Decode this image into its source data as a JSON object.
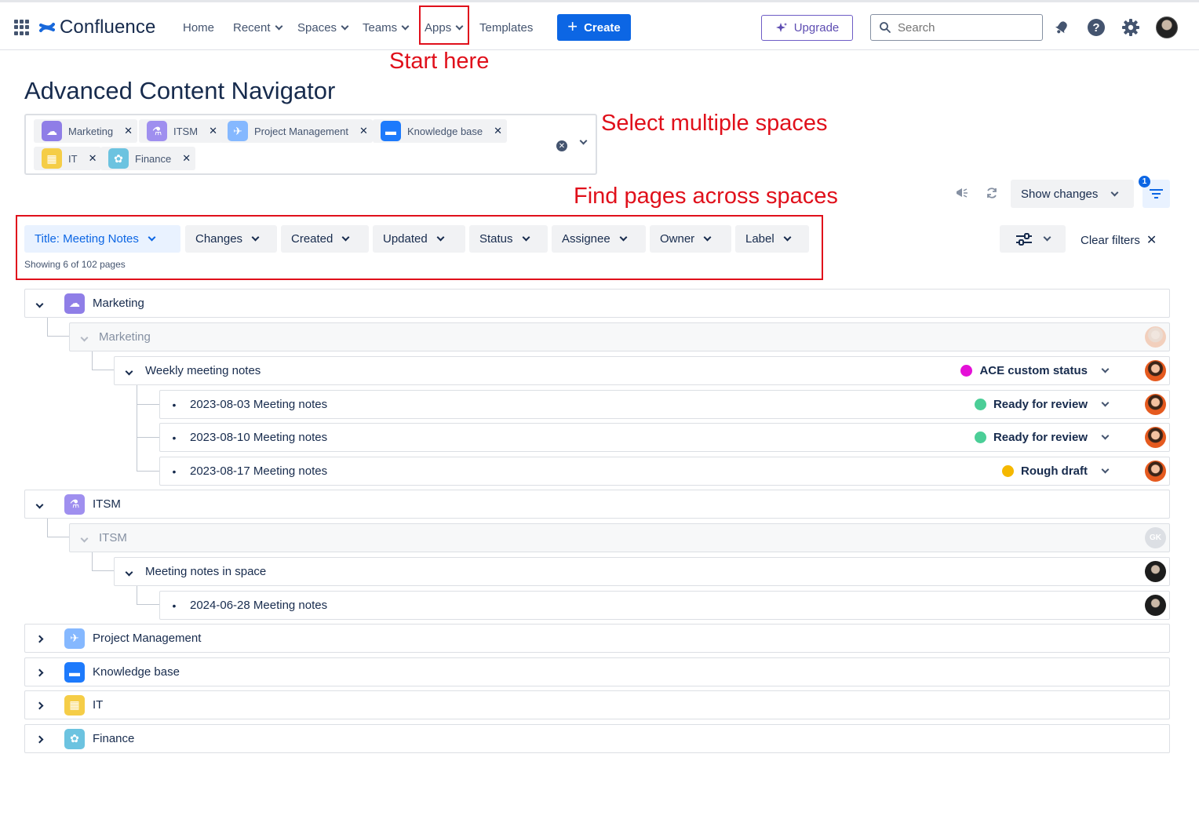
{
  "nav": {
    "brand": "Confluence",
    "items": [
      {
        "label": "Home",
        "dropdown": false
      },
      {
        "label": "Recent",
        "dropdown": true
      },
      {
        "label": "Spaces",
        "dropdown": true
      },
      {
        "label": "Teams",
        "dropdown": true
      },
      {
        "label": "Apps",
        "dropdown": true
      },
      {
        "label": "Templates",
        "dropdown": false
      }
    ],
    "create_label": "Create",
    "upgrade_label": "Upgrade",
    "search_placeholder": "Search",
    "icons": [
      "app-switcher-icon",
      "notifications-icon",
      "help-icon",
      "settings-icon",
      "profile-avatar"
    ]
  },
  "annotations": {
    "start_here": "Start here",
    "select_spaces": "Select multiple spaces",
    "find_pages": "Find pages across spaces",
    "color": "#e0101b"
  },
  "page": {
    "title": "Advanced Content Navigator"
  },
  "selected_spaces": [
    {
      "name": "Marketing",
      "icon": "marketing-space-icon"
    },
    {
      "name": "ITSM",
      "icon": "itsm-space-icon"
    },
    {
      "name": "Project Management",
      "icon": "project-management-space-icon"
    },
    {
      "name": "Knowledge base",
      "icon": "knowledge-base-space-icon"
    },
    {
      "name": "IT",
      "icon": "it-space-icon"
    },
    {
      "name": "Finance",
      "icon": "finance-space-icon"
    }
  ],
  "toolbar": {
    "show_changes": "Show changes",
    "filter_badge": "1"
  },
  "filters": {
    "buttons": [
      "Title: Meeting Notes",
      "Changes",
      "Created",
      "Updated",
      "Status",
      "Assignee",
      "Owner",
      "Label"
    ],
    "showing": "Showing 6 of 102 pages",
    "clear_filters": "Clear filters"
  },
  "tree": {
    "marketing": {
      "space": "Marketing",
      "home": "Marketing",
      "parent": "Weekly meeting notes",
      "parent_status": {
        "label": "ACE custom status",
        "color": "#e410d7"
      },
      "pages": [
        {
          "title": "2023-08-03 Meeting notes",
          "status": "Ready for review",
          "color": "#4bce97"
        },
        {
          "title": "2023-08-10 Meeting notes",
          "status": "Ready for review",
          "color": "#4bce97"
        },
        {
          "title": "2023-08-17 Meeting notes",
          "status": "Rough draft",
          "color": "#f5b800"
        }
      ]
    },
    "itsm": {
      "space": "ITSM",
      "home": "ITSM",
      "home_avatar": "GK",
      "parent": "Meeting notes in space",
      "pages": [
        {
          "title": "2024-06-28 Meeting notes"
        }
      ]
    },
    "collapsed_spaces": [
      "Project Management",
      "Knowledge base",
      "IT",
      "Finance"
    ]
  },
  "colors": {
    "brand_blue": "#0c66e4",
    "upgrade_purple": "#6e5dc6"
  }
}
